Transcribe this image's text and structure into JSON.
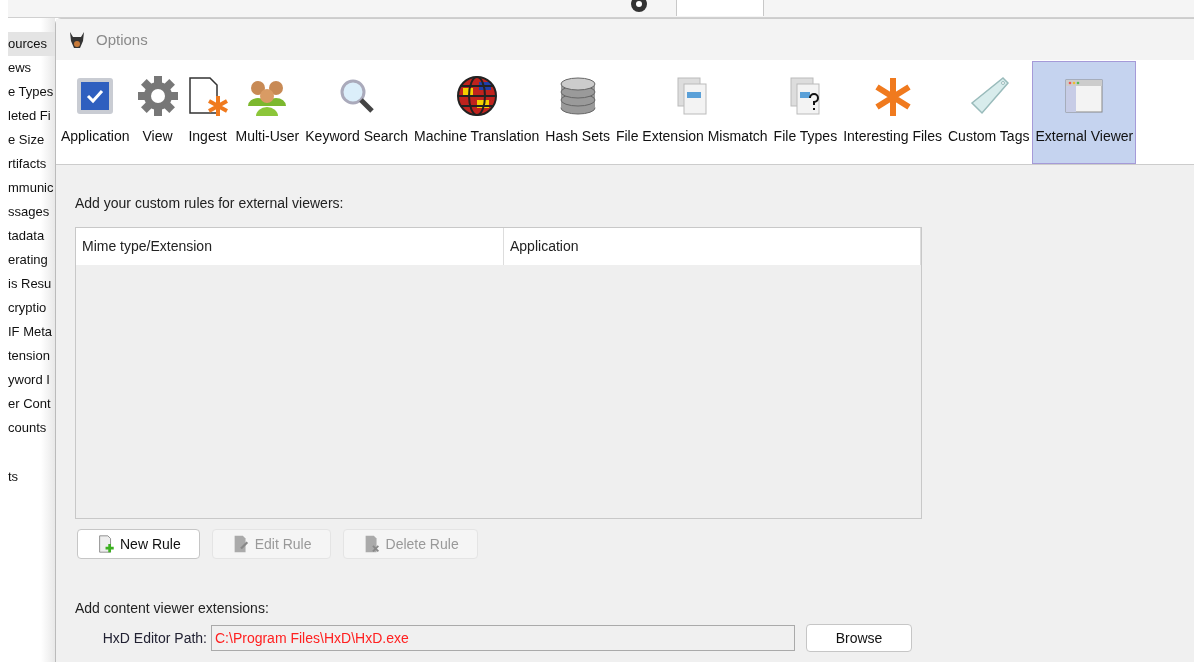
{
  "background_tree": {
    "items": [
      {
        "label": "ources",
        "selected": true
      },
      {
        "label": "ews",
        "selected": false
      },
      {
        "label": "e Types",
        "selected": false
      },
      {
        "label": "leted Fi",
        "selected": false
      },
      {
        "label": "e Size",
        "selected": false
      },
      {
        "label": "rtifacts",
        "selected": false
      },
      {
        "label": "mmunic",
        "selected": false
      },
      {
        "label": "ssages",
        "selected": false
      },
      {
        "label": "tadata",
        "selected": false
      },
      {
        "label": "erating",
        "selected": false
      },
      {
        "label": "is Resu",
        "selected": false
      },
      {
        "label": "cryptio",
        "selected": false
      },
      {
        "label": "IF Meta",
        "selected": false
      },
      {
        "label": "tension",
        "selected": false
      },
      {
        "label": "yword I",
        "selected": false
      },
      {
        "label": "er Cont",
        "selected": false
      },
      {
        "label": "counts",
        "selected": false
      },
      {
        "label": "ts",
        "selected": false,
        "gap_before": true
      }
    ]
  },
  "window": {
    "title": "Options"
  },
  "tabs": [
    {
      "label": "Application",
      "selected": false
    },
    {
      "label": "View",
      "selected": false
    },
    {
      "label": "Ingest",
      "selected": false
    },
    {
      "label": "Multi-User",
      "selected": false
    },
    {
      "label": "Keyword Search",
      "selected": false
    },
    {
      "label": "Machine Translation",
      "selected": false
    },
    {
      "label": "Hash Sets",
      "selected": false
    },
    {
      "label": "File Extension Mismatch",
      "selected": false
    },
    {
      "label": "File Types",
      "selected": false
    },
    {
      "label": "Interesting Files",
      "selected": false
    },
    {
      "label": "Custom Tags",
      "selected": false
    },
    {
      "label": "External Viewer",
      "selected": true
    }
  ],
  "rules_label": "Add your custom rules for external viewers:",
  "table": {
    "columns": [
      "Mime type/Extension",
      "Application"
    ]
  },
  "rule_buttons": [
    {
      "label": "New Rule",
      "disabled": false,
      "kind": "new"
    },
    {
      "label": "Edit Rule",
      "disabled": true,
      "kind": "edit"
    },
    {
      "label": "Delete Rule",
      "disabled": true,
      "kind": "delete"
    }
  ],
  "extensions_label": "Add content viewer extensions:",
  "hxd": {
    "label": "HxD Editor Path:",
    "value": "C:\\Program Files\\HxD\\HxD.exe",
    "invalid": true,
    "button": "Browse"
  }
}
